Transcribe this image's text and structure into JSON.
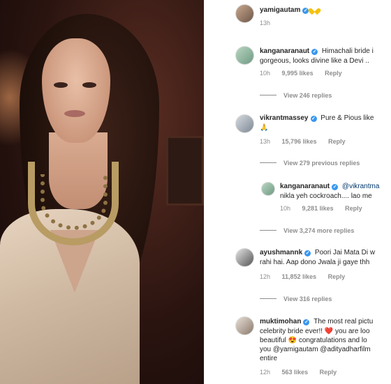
{
  "post": {
    "photo_icon": "photo-portrait"
  },
  "comments": [
    {
      "id": "c1",
      "username": "yamigautam",
      "verified": true,
      "text": "",
      "emoji": "yellow-heart",
      "time": "13h",
      "likes": "",
      "reply": ""
    },
    {
      "id": "c2",
      "username": "kanganaranaut",
      "verified": true,
      "text": "Himachali bride i",
      "text2": "gorgeous, looks divine like a Devi ..",
      "time": "10h",
      "likes": "9,995 likes",
      "reply": "Reply",
      "view_replies": "View 246 replies"
    },
    {
      "id": "c3",
      "username": "vikrantmassey",
      "verified": true,
      "text": "Pure & Pious like",
      "text2": "🙏",
      "time": "13h",
      "likes": "15,796 likes",
      "reply": "Reply",
      "view_replies": "View 279 previous replies"
    },
    {
      "id": "c4",
      "username": "kanganaranaut",
      "verified": true,
      "text": "@vikrantma",
      "text2": "nikla yeh cockroach.... lao me",
      "time": "10h",
      "likes": "9,281 likes",
      "reply": "Reply",
      "view_replies": "View 3,274 more replies"
    },
    {
      "id": "c5",
      "username": "ayushmannk",
      "verified": true,
      "text": "Poori Jai Mata Di w",
      "text2": "rahi hai. Aap dono Jwala ji gaye thh",
      "time": "12h",
      "likes": "11,852 likes",
      "reply": "Reply",
      "view_replies": "View 316 replies"
    },
    {
      "id": "c6",
      "username": "muktimohan",
      "verified": true,
      "text": "The most real pictu",
      "text2": "celebrity bride ever!! ❤️ you are loo",
      "text3": "beautiful 😍 congratulations and lo",
      "text4": "you @yamigautam @adityadharfilm",
      "text5": "entire",
      "time": "12h",
      "likes": "563 likes",
      "reply": "Reply"
    }
  ],
  "colors": {
    "verified": "#3897f0",
    "meta": "#8e8e8e",
    "text": "#262626"
  }
}
